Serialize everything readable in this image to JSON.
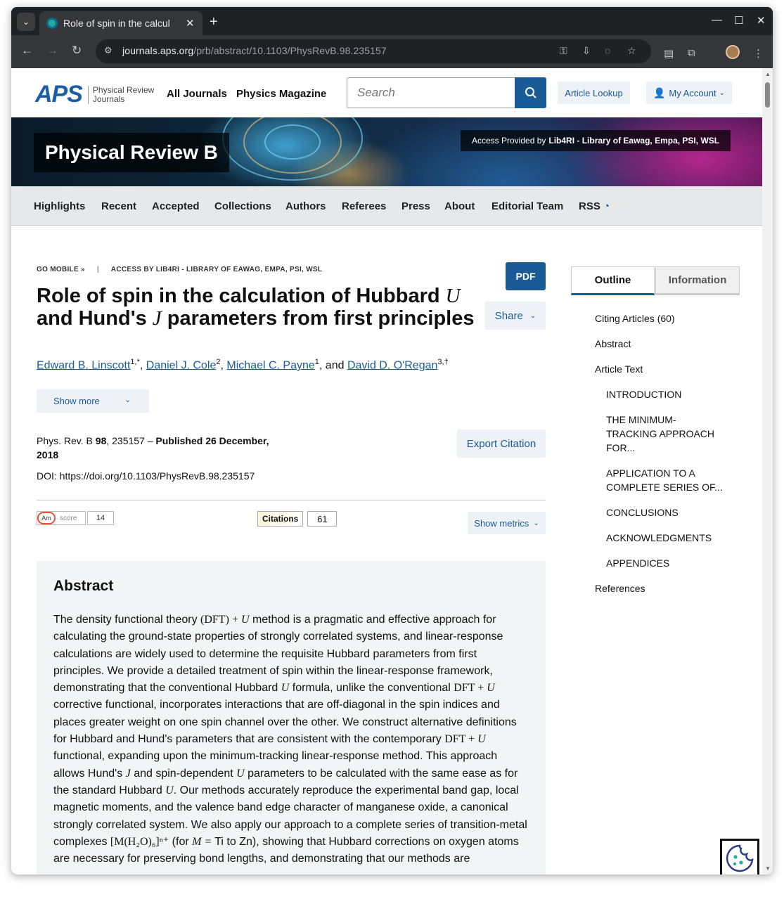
{
  "browser": {
    "tab_title": "Role of spin in the calcul",
    "url_host": "journals.aps.org",
    "url_path": "/prb/abstract/10.1103/PhysRevB.98.235157"
  },
  "header": {
    "logo_text": "APS",
    "logo_sub_line1": "Physical Review",
    "logo_sub_line2": "Journals",
    "nav_all_journals": "All Journals",
    "nav_physics_magazine": "Physics Magazine",
    "search_placeholder": "Search",
    "article_lookup": "Article Lookup",
    "my_account": "My Account"
  },
  "banner": {
    "journal_title": "Physical Review B",
    "access_prefix": "Access Provided by",
    "access_org": "Lib4RI - Library of Eawag, Empa, PSI, WSL"
  },
  "journal_nav": [
    "Highlights",
    "Recent",
    "Accepted",
    "Collections",
    "Authors",
    "Referees",
    "Press",
    "About",
    "Editorial Team",
    "RSS"
  ],
  "article": {
    "go_mobile": "GO MOBILE »",
    "access_crumb": "ACCESS BY LIB4RI - LIBRARY OF EAWAG, EMPA, PSI, WSL",
    "pdf": "PDF",
    "share": "Share",
    "title_part1": "Role of spin in the calculation of Hubbard ",
    "title_u": "U",
    "title_part2": " and Hund's ",
    "title_j": "J",
    "title_part3": " parameters from first principles",
    "authors": [
      {
        "name": "Edward B. Linscott",
        "sup": "1,*"
      },
      {
        "name": "Daniel J. Cole",
        "sup": "2"
      },
      {
        "name": "Michael C. Payne",
        "sup": "1"
      },
      {
        "name": "David D. O'Regan",
        "sup": "3,†"
      }
    ],
    "and": "and",
    "show_more": "Show more",
    "journal_ref": "Phys. Rev. B ",
    "volume": "98",
    "article_no": ", 235157 – ",
    "published": "Published 26 December, 2018",
    "doi": "DOI: https://doi.org/10.1103/PhysRevB.98.235157",
    "export_citation": "Export Citation",
    "altmetric_label": "score",
    "altmetric_am": "Am",
    "altmetric_score": "14",
    "citations_label": "Citations",
    "citations_count": "61",
    "show_metrics": "Show metrics"
  },
  "abstract": {
    "heading": "Abstract",
    "s1": "The density functional theory ",
    "s2": " method is a pragmatic and effective approach for calculating the ground-state properties of strongly correlated systems, and linear-response calculations are widely used to determine the requisite Hubbard parameters from first principles. We provide a detailed treatment of spin within the linear-response framework, demonstrating that the conventional Hubbard ",
    "s3": " formula, unlike the conventional ",
    "s4": " corrective functional, incorporates interactions that are off-diagonal in the spin indices and places greater weight on one spin channel over the other. We construct alternative definitions for Hubbard and Hund's parameters that are consistent with the contemporary ",
    "s5": " functional, expanding upon the minimum-tracking linear-response method. This approach allows Hund's ",
    "s6": " and spin-dependent ",
    "s7": " parameters to be calculated with the same ease as for the standard Hubbard ",
    "s8": ". Our methods accurately reproduce the experimental band gap, local magnetic moments, and the valence band edge character of manganese oxide, a canonical strongly correlated system. We also apply our approach to a complete series of transition-metal complexes ",
    "s9": " (for ",
    "s10": " Ti to Zn), showing that Hubbard corrections on oxygen atoms are necessary for preserving bond lengths, and demonstrating that our methods are",
    "m_dft": "(DFT)",
    "m_plus": " + ",
    "m_u": "U",
    "m_j": "J",
    "m_dft2": "DFT",
    "m_complex": "[M(H₂O)₆]ⁿ⁺",
    "m_meq": "M = "
  },
  "sidebar": {
    "tab_outline": "Outline",
    "tab_information": "Information",
    "items": [
      {
        "label": "Citing Articles (60)",
        "level": 0
      },
      {
        "label": "Abstract",
        "level": 0
      },
      {
        "label": "Article Text",
        "level": 0
      },
      {
        "label": "INTRODUCTION",
        "level": 1
      },
      {
        "label": "THE MINIMUM-TRACKING APPROACH FOR...",
        "level": 1
      },
      {
        "label": "APPLICATION TO A COMPLETE SERIES OF...",
        "level": 1
      },
      {
        "label": "CONCLUSIONS",
        "level": 1
      },
      {
        "label": "ACKNOWLEDGMENTS",
        "level": 1
      },
      {
        "label": "APPENDICES",
        "level": 1
      },
      {
        "label": "References",
        "level": 0
      }
    ]
  },
  "colors": {
    "brand": "#1a5a96",
    "button_bg": "#eef2f6"
  }
}
